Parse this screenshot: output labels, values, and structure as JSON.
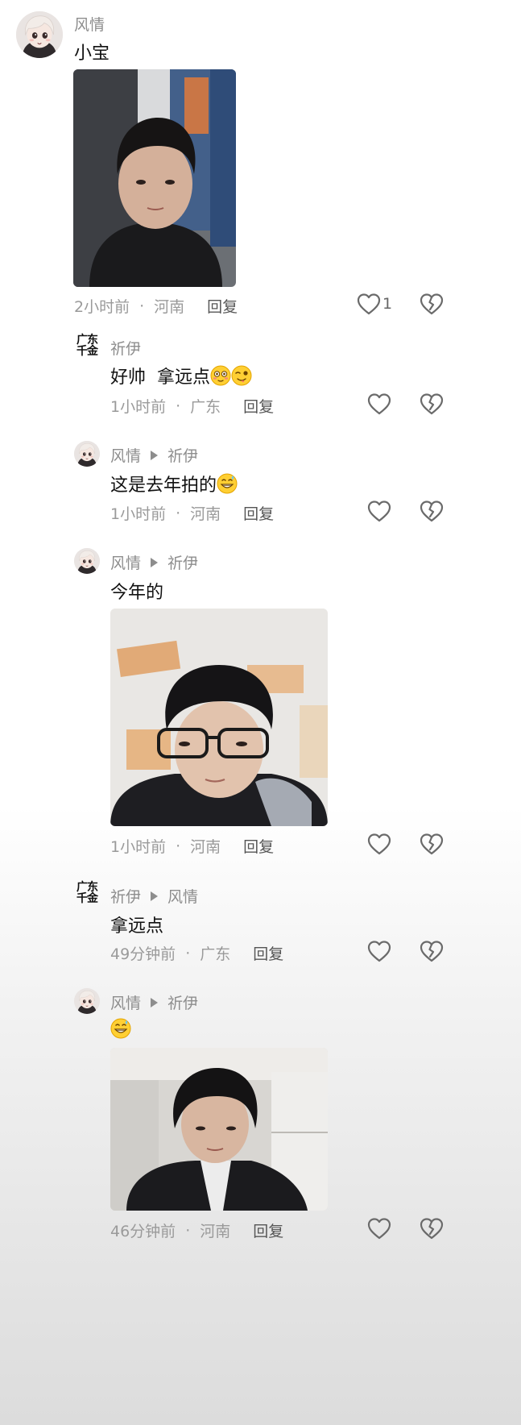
{
  "comments": [
    {
      "author": "风情",
      "text": "小宝",
      "time": "2小时前",
      "location": "河南",
      "reply_label": "回复",
      "like_count": "1",
      "replies": [
        {
          "author": "祈伊",
          "badge_top": "广东",
          "badge_bottom": "千金",
          "text": "好帅  拿远点",
          "time": "1小时前",
          "location": "广东",
          "reply_label": "回复"
        },
        {
          "author": "风情",
          "reply_to": "祈伊",
          "text": "这是去年拍的",
          "time": "1小时前",
          "location": "河南",
          "reply_label": "回复"
        },
        {
          "author": "风情",
          "reply_to": "祈伊",
          "text": "今年的",
          "time": "1小时前",
          "location": "河南",
          "reply_label": "回复"
        },
        {
          "author": "祈伊",
          "reply_to": "风情",
          "badge_top": "广东",
          "badge_bottom": "千金",
          "text": "拿远点",
          "time": "49分钟前",
          "location": "广东",
          "reply_label": "回复"
        },
        {
          "author": "风情",
          "reply_to": "祈伊",
          "text": "",
          "time": "46分钟前",
          "location": "河南",
          "reply_label": "回复"
        }
      ]
    }
  ],
  "separator": "·",
  "icons": {
    "like": "heart-outline-icon",
    "dislike": "broken-heart-icon",
    "reply_arrow": "triangle-right-icon"
  }
}
